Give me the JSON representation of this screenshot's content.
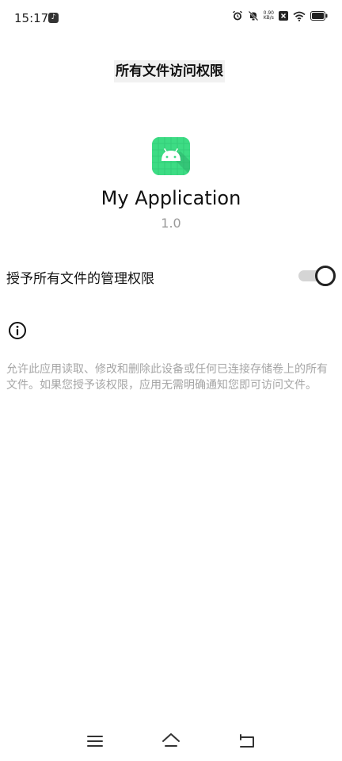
{
  "status_bar": {
    "time": "15:17",
    "app_notification_icon": "tiktok-icon",
    "net_speed_value": "0.90",
    "net_speed_unit": "KB/s",
    "icons": [
      "alarm-icon",
      "silent-icon",
      "close-box-icon",
      "wifi-icon",
      "battery-icon"
    ]
  },
  "page": {
    "title": "所有文件访问权限"
  },
  "app": {
    "icon": "android-app-icon",
    "name": "My Application",
    "version": "1.0"
  },
  "permission": {
    "label": "授予所有文件的管理权限",
    "enabled": true
  },
  "info": {
    "icon": "info-icon",
    "description": "允许此应用读取、修改和删除此设备或任何已连接存储卷上的所有文件。如果您授予该权限，应用无需明确通知您即可访问文件。"
  },
  "nav_bar": {
    "items": [
      "menu-icon",
      "home-icon",
      "back-icon"
    ]
  },
  "colors": {
    "app_icon_bg": "#3ddc84",
    "secondary_text": "#9a9a9a",
    "toggle_track": "#d5d5d5"
  }
}
